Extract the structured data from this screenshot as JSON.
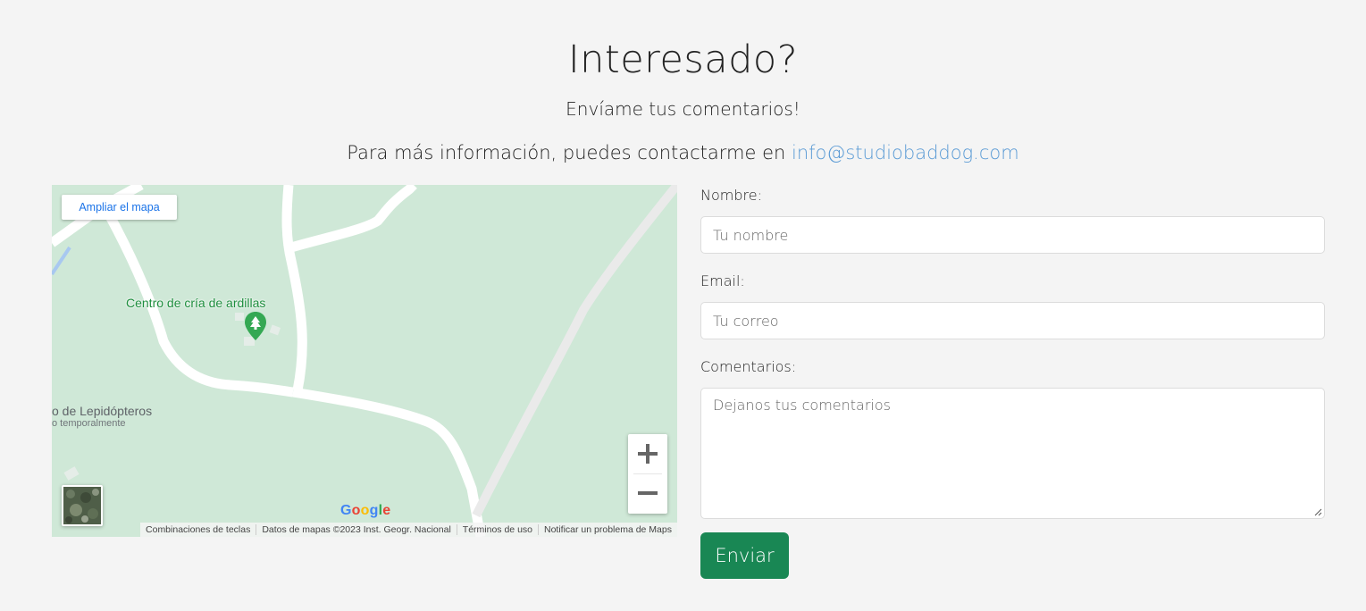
{
  "header": {
    "title": "Interesado?",
    "subtitle": "Envíame tus comentarios!",
    "contact_prefix": "Para más información, puedes contactarme en ",
    "contact_email": "info@studiobaddog.com"
  },
  "map": {
    "enlarge_label": "Ampliar el mapa",
    "poi_label": "Centro de cría de ardillas",
    "poi2_label": "o de Lepidópteros",
    "poi2_sub": "o temporalmente",
    "logo": [
      "G",
      "o",
      "o",
      "g",
      "l",
      "e"
    ],
    "attribution": [
      "Combinaciones de teclas",
      "Datos de mapas ©2023 Inst. Geogr. Nacional",
      "Términos de uso",
      "Notificar un problema de Maps"
    ],
    "zoom_in_icon": "plus-icon",
    "zoom_out_icon": "minus-icon",
    "colors": {
      "land": "#cfe8d7",
      "road": "#ffffff",
      "poi": "#1e8e3e",
      "water": "#a8c8f0"
    }
  },
  "form": {
    "name_label": "Nombre:",
    "name_placeholder": "Tu nombre",
    "email_label": "Email:",
    "email_placeholder": "Tu correo",
    "comments_label": "Comentarios:",
    "comments_placeholder": "Dejanos tus comentarios",
    "submit_label": "Enviar",
    "submit_color": "#198754"
  }
}
